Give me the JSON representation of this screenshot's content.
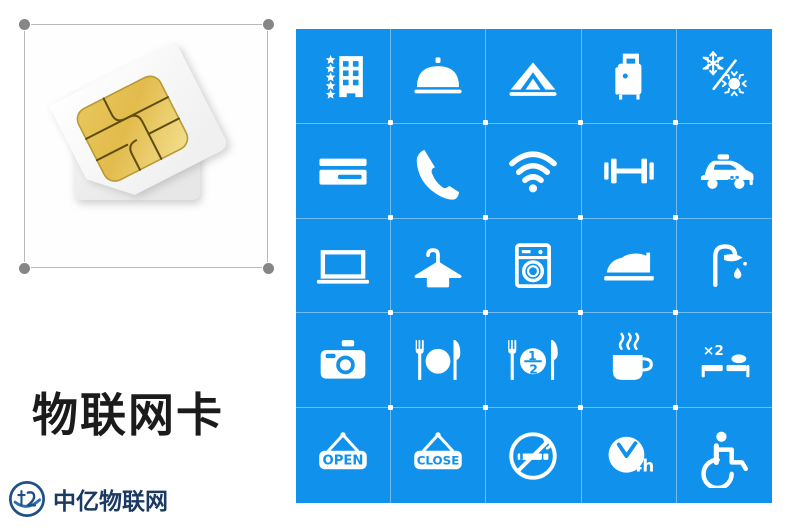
{
  "page": {
    "background_color": "#ffffff",
    "accent_color": "#0f91ec",
    "icon_color": "#ffffff",
    "handle_color": "#868686"
  },
  "left_panel": {
    "selection": {
      "name": "image-selection-frame",
      "handles": [
        "top-left",
        "top-right",
        "bottom-left",
        "bottom-right"
      ]
    },
    "artwork": {
      "name": "sim-card-illustration",
      "description": "two white SIM cards with gold contact chips"
    },
    "title": "物联网卡",
    "watermark": {
      "logo_label": "中亿",
      "text": "中亿物联网",
      "color": "#1b3a63"
    }
  },
  "icon_grid": {
    "columns": 5,
    "rows": 5,
    "tile_color": "#0f91ec",
    "divider_color": "#ffffff",
    "cells": [
      {
        "name": "hotel-star-rating-icon",
        "label": "5-star hotel",
        "stars": 5
      },
      {
        "name": "room-service-bell-icon",
        "label": "Room service"
      },
      {
        "name": "tent-camping-icon",
        "label": "Camping / tent"
      },
      {
        "name": "luggage-icon",
        "label": "Luggage storage"
      },
      {
        "name": "air-conditioning-icon",
        "label": "Heating and cooling"
      },
      {
        "name": "credit-card-icon",
        "label": "Card payment"
      },
      {
        "name": "telephone-icon",
        "label": "Telephone"
      },
      {
        "name": "wifi-icon",
        "label": "Wi-Fi"
      },
      {
        "name": "dumbbell-gym-icon",
        "label": "Fitness / gym"
      },
      {
        "name": "taxi-icon",
        "label": "Taxi service"
      },
      {
        "name": "television-icon",
        "label": "Television"
      },
      {
        "name": "clothes-hanger-icon",
        "label": "Wardrobe / laundry"
      },
      {
        "name": "washing-machine-icon",
        "label": "Washing machine"
      },
      {
        "name": "iron-icon",
        "label": "Iron"
      },
      {
        "name": "shower-icon",
        "label": "Shower"
      },
      {
        "name": "camera-icon",
        "label": "Camera / photos"
      },
      {
        "name": "restaurant-icon",
        "label": "Restaurant"
      },
      {
        "name": "half-board-icon",
        "label": "Half board",
        "text": "1/2"
      },
      {
        "name": "coffee-cup-icon",
        "label": "Coffee / breakfast"
      },
      {
        "name": "twin-beds-icon",
        "label": "Twin beds",
        "text": "×2"
      },
      {
        "name": "open-sign-icon",
        "label": "Open",
        "text": "OPEN"
      },
      {
        "name": "close-sign-icon",
        "label": "Closed",
        "text": "CLOSE"
      },
      {
        "name": "no-smoking-icon",
        "label": "No smoking"
      },
      {
        "name": "24-hour-service-icon",
        "label": "24 hour service",
        "text": "24h"
      },
      {
        "name": "wheelchair-accessible-icon",
        "label": "Wheelchair accessible"
      }
    ]
  }
}
